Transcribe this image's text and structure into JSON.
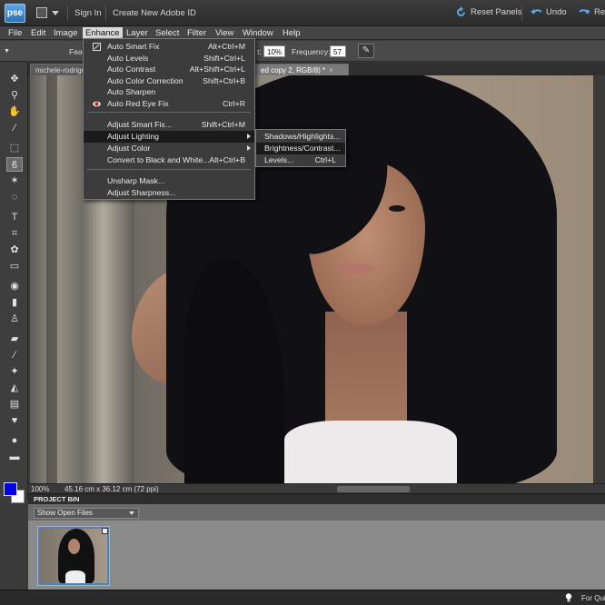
{
  "titlebar": {
    "app_logo": "pse",
    "sign_in": "Sign In",
    "create_id": "Create New Adobe ID",
    "reset_panels": "Reset Panels",
    "undo": "Undo",
    "redo": "Red"
  },
  "menubar": {
    "items": [
      "File",
      "Edit",
      "Image",
      "Enhance",
      "Layer",
      "Select",
      "Filter",
      "View",
      "Window",
      "Help"
    ],
    "open_menu": "Enhance"
  },
  "optionsbar": {
    "feat_label": "Feat",
    "exposure_label": "t:",
    "exposure_value": "10%",
    "frequency_label": "Frequency:",
    "frequency_value": "57"
  },
  "tabs": [
    {
      "label": "michele-rodrigu",
      "active": false
    },
    {
      "label": "ed copy 2, RGB/8) *",
      "active": true
    }
  ],
  "tab_close": "×",
  "enhance_menu": {
    "items": [
      {
        "label": "Auto Smart Fix",
        "shortcut": "Alt+Ctrl+M",
        "icon": "smart-fix-icon"
      },
      {
        "label": "Auto Levels",
        "shortcut": "Shift+Ctrl+L"
      },
      {
        "label": "Auto Contrast",
        "shortcut": "Alt+Shift+Ctrl+L"
      },
      {
        "label": "Auto Color Correction",
        "shortcut": "Shift+Ctrl+B"
      },
      {
        "label": "Auto Sharpen",
        "shortcut": ""
      },
      {
        "label": "Auto Red Eye Fix",
        "shortcut": "Ctrl+R",
        "icon": "red-eye-icon"
      },
      {
        "label": "Adjust Smart Fix...",
        "shortcut": "Shift+Ctrl+M"
      },
      {
        "label": "Adjust Lighting",
        "shortcut": "",
        "submenu": true
      },
      {
        "label": "Adjust Color",
        "shortcut": "",
        "submenu": true
      },
      {
        "label": "Convert to Black and White...",
        "shortcut": "Alt+Ctrl+B"
      },
      {
        "label": "Unsharp Mask...",
        "shortcut": ""
      },
      {
        "label": "Adjust Sharpness...",
        "shortcut": ""
      }
    ],
    "highlighted": "Adjust Lighting"
  },
  "lighting_submenu": {
    "items": [
      {
        "label": "Shadows/Highlights...",
        "shortcut": ""
      },
      {
        "label": "Brightness/Contrast...",
        "shortcut": ""
      },
      {
        "label": "Levels...",
        "shortcut": "Ctrl+L"
      }
    ],
    "highlighted": "Brightness/Contrast..."
  },
  "statusbar": {
    "zoom": "100%",
    "doc_size": "45.16 cm x 36.12 cm (72 ppi)"
  },
  "project_bin": {
    "title": "PROJECT BIN",
    "show_select": "Show Open Files"
  },
  "bottombar": {
    "text": "For Quic"
  },
  "colors": {
    "foreground": "#0000ee",
    "background": "#ffffff"
  }
}
